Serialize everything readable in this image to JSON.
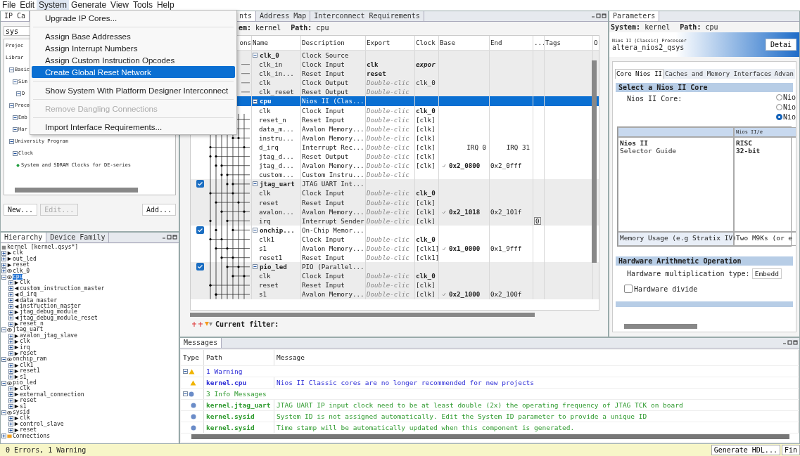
{
  "menubar": [
    {
      "label": "File",
      "open": false
    },
    {
      "label": "Edit",
      "open": false
    },
    {
      "label": "System",
      "open": true
    },
    {
      "label": "Generate",
      "open": false
    },
    {
      "label": "View",
      "open": false
    },
    {
      "label": "Tools",
      "open": false
    },
    {
      "label": "Help",
      "open": false
    }
  ],
  "system_menu": [
    {
      "kind": "item",
      "label": "Upgrade IP Cores...",
      "selected": false,
      "disabled": false
    },
    {
      "kind": "separator"
    },
    {
      "kind": "item",
      "label": "Assign Base Addresses",
      "selected": false,
      "disabled": false
    },
    {
      "kind": "item",
      "label": "Assign Interrupt Numbers",
      "selected": false,
      "disabled": false
    },
    {
      "kind": "item",
      "label": "Assign Custom Instruction Opcodes",
      "selected": false,
      "disabled": false
    },
    {
      "kind": "item",
      "label": "Create Global Reset Network",
      "selected": true,
      "disabled": false
    },
    {
      "kind": "separator"
    },
    {
      "kind": "item",
      "label": "Show System With Platform Designer Interconnect",
      "selected": false,
      "disabled": false
    },
    {
      "kind": "separator"
    },
    {
      "kind": "item",
      "label": "Remove Dangling Connections",
      "selected": false,
      "disabled": true
    },
    {
      "kind": "separator"
    },
    {
      "kind": "item",
      "label": "Import Interface Requirements...",
      "selected": false,
      "disabled": false
    }
  ],
  "ip_catalog": {
    "tab": "IP Ca",
    "search": "sys",
    "tree": [
      {
        "label": "Projec"
      },
      {
        "label": "Librar",
        "children": [
          {
            "label": "Basic",
            "expanded": true,
            "children": [
              {
                "label": "Sim",
                "expanded": true,
                "children": [
                  {
                    "label": "D",
                    "expanded": true
                  }
                ]
              }
            ]
          },
          {
            "label": "Proce",
            "expanded": true,
            "children": [
              {
                "label": "Emb",
                "expanded": true
              },
              {
                "label": "Har",
                "expanded": true
              }
            ]
          },
          {
            "label": "University Program",
            "expanded": true,
            "children": [
              {
                "label": "Clock",
                "expanded": true,
                "children": [
                  {
                    "label": "System and SDRAM Clocks for DE-series"
                  }
                ]
              }
            ]
          }
        ]
      }
    ],
    "buttons": [
      {
        "label": "New...",
        "disabled": false
      },
      {
        "label": "Edit...",
        "disabled": true
      },
      {
        "label": "Add...",
        "disabled": false
      }
    ]
  },
  "hierarchy": {
    "tabs": [
      {
        "label": "Hierarchy",
        "selected": true
      },
      {
        "label": "Device Family",
        "selected": false
      }
    ],
    "tree": {
      "label": "kernel [kernel.qsys*]",
      "kind": "system",
      "children": [
        {
          "label": "clk",
          "kind": "in",
          "expanded": false
        },
        {
          "label": "out_led",
          "kind": "in",
          "expanded": false
        },
        {
          "label": "reset",
          "kind": "in",
          "expanded": false
        },
        {
          "label": "clk_0",
          "kind": "module",
          "expanded": false
        },
        {
          "label": "cpu",
          "kind": "module",
          "expanded": true,
          "selected": true,
          "children": [
            {
              "label": "clk",
              "kind": "in",
              "expanded": false
            },
            {
              "label": "custom_instruction_master",
              "kind": "out",
              "expanded": false
            },
            {
              "label": "d_irq",
              "kind": "out",
              "expanded": false
            },
            {
              "label": "data_master",
              "kind": "out",
              "expanded": false
            },
            {
              "label": "instruction_master",
              "kind": "out",
              "expanded": false
            },
            {
              "label": "jtag_debug_module",
              "kind": "in",
              "expanded": false
            },
            {
              "label": "jtag_debug_module_reset",
              "kind": "out",
              "expanded": false
            },
            {
              "label": "reset_n",
              "kind": "in",
              "expanded": false
            }
          ]
        },
        {
          "label": "jtag_uart",
          "kind": "module",
          "expanded": true,
          "children": [
            {
              "label": "avalon_jtag_slave",
              "kind": "in",
              "expanded": false
            },
            {
              "label": "clk",
              "kind": "in",
              "expanded": false
            },
            {
              "label": "irq",
              "kind": "in",
              "expanded": false
            },
            {
              "label": "reset",
              "kind": "in",
              "expanded": false
            }
          ]
        },
        {
          "label": "onchip_ram",
          "kind": "module",
          "expanded": true,
          "children": [
            {
              "label": "clk1",
              "kind": "in",
              "expanded": false
            },
            {
              "label": "reset1",
              "kind": "in",
              "expanded": false
            },
            {
              "label": "s1",
              "kind": "in",
              "expanded": false
            }
          ]
        },
        {
          "label": "pio_led",
          "kind": "module",
          "expanded": true,
          "children": [
            {
              "label": "clk",
              "kind": "in",
              "expanded": false
            },
            {
              "label": "external_connection",
              "kind": "in",
              "expanded": false
            },
            {
              "label": "reset",
              "kind": "in",
              "expanded": false
            },
            {
              "label": "s1",
              "kind": "in",
              "expanded": false
            }
          ]
        },
        {
          "label": "sysid",
          "kind": "module",
          "expanded": true,
          "children": [
            {
              "label": "clk",
              "kind": "in",
              "expanded": false
            },
            {
              "label": "control_slave",
              "kind": "in",
              "expanded": false
            },
            {
              "label": "reset",
              "kind": "in",
              "expanded": false
            }
          ]
        },
        {
          "label": "Connections",
          "kind": "folder",
          "expanded": false
        }
      ]
    }
  },
  "system_contents": {
    "tabs": [
      {
        "label": "nts",
        "selected": true
      },
      {
        "label": "Address Map",
        "selected": false
      },
      {
        "label": "Interconnect Requirements",
        "selected": false
      }
    ],
    "system_label": "em:",
    "system": "kernel",
    "path_label": "Path:",
    "path": "cpu",
    "columns": [
      "ons",
      "Name",
      "Description",
      "Export",
      "Clock",
      "Base",
      "End",
      "...",
      "Tags",
      "O"
    ],
    "modules": [
      {
        "name": "clk_0",
        "description": "Clock Source",
        "selected": false,
        "expanded": true,
        "ports": [
          {
            "name": "clk_in",
            "description": "Clock Input",
            "export": {
              "text": "clk",
              "kind": "name"
            },
            "clock": {
              "text": "expor",
              "kind": "italic"
            }
          },
          {
            "name": "clk_in...",
            "description": "Reset Input",
            "export": {
              "text": "reset",
              "kind": "name"
            }
          },
          {
            "name": "clk",
            "description": "Clock Output",
            "export": {
              "text": "Double-clic",
              "kind": "hint"
            },
            "clock": {
              "text": "clk_0",
              "kind": "plain"
            }
          },
          {
            "name": "clk_reset",
            "description": "Reset Output",
            "export": {
              "text": "Double-clic",
              "kind": "hint"
            }
          }
        ]
      },
      {
        "name": "cpu",
        "description": "Nios II (Clas...",
        "selected": true,
        "expanded": true,
        "ports": [
          {
            "name": "clk",
            "description": "Clock Input",
            "export": {
              "text": "Double-clic",
              "kind": "hint"
            },
            "clock": {
              "text": "clk_0",
              "kind": "bold"
            }
          },
          {
            "name": "reset_n",
            "description": "Reset Input",
            "export": {
              "text": "Double-clic",
              "kind": "hint"
            },
            "clock": {
              "text": "[clk]",
              "kind": "plain"
            }
          },
          {
            "name": "data_m...",
            "description": "Avalon Memory...",
            "export": {
              "text": "Double-clic",
              "kind": "hint"
            },
            "clock": {
              "text": "[clk]",
              "kind": "plain"
            }
          },
          {
            "name": "instru...",
            "description": "Avalon Memory...",
            "export": {
              "text": "Double-clic",
              "kind": "hint"
            },
            "clock": {
              "text": "[clk]",
              "kind": "plain"
            }
          },
          {
            "name": "d_irq",
            "description": "Interrupt Rec...",
            "export": {
              "text": "Double-clic",
              "kind": "hint"
            },
            "clock": {
              "text": "[clk]",
              "kind": "plain"
            },
            "base": {
              "text": "IRQ 0",
              "kind": "irq"
            },
            "end": "IRQ 31"
          },
          {
            "name": "jtag_d...",
            "description": "Reset Output",
            "export": {
              "text": "Double-clic",
              "kind": "hint"
            },
            "clock": {
              "text": "[clk]",
              "kind": "plain"
            }
          },
          {
            "name": "jtag_d...",
            "description": "Avalon Memory...",
            "export": {
              "text": "Double-clic",
              "kind": "hint"
            },
            "clock": {
              "text": "[clk]",
              "kind": "plain"
            },
            "base": {
              "text": "0x2_0800",
              "kind": "address"
            },
            "end": "0x2_0fff"
          },
          {
            "name": "custom...",
            "description": "Custom Instru...",
            "export": {
              "text": "Double-clic",
              "kind": "hint"
            }
          }
        ]
      },
      {
        "name": "jtag_uart",
        "description": "JTAG UART Int...",
        "checked": true,
        "selected": false,
        "expanded": true,
        "ports": [
          {
            "name": "clk",
            "description": "Clock Input",
            "export": {
              "text": "Double-clic",
              "kind": "hint"
            },
            "clock": {
              "text": "clk_0",
              "kind": "bold"
            }
          },
          {
            "name": "reset",
            "description": "Reset Input",
            "export": {
              "text": "Double-clic",
              "kind": "hint"
            },
            "clock": {
              "text": "[clk]",
              "kind": "plain"
            }
          },
          {
            "name": "avalon...",
            "description": "Avalon Memory...",
            "export": {
              "text": "Double-clic",
              "kind": "hint"
            },
            "clock": {
              "text": "[clk]",
              "kind": "plain"
            },
            "base": {
              "text": "0x2_1018",
              "kind": "address"
            },
            "end": "0x2_101f"
          },
          {
            "name": "irq",
            "description": "Interrupt Sender",
            "export": {
              "text": "Double-clic",
              "kind": "hint"
            },
            "clock": {
              "text": "[clk]",
              "kind": "plain"
            },
            "irq": "0"
          }
        ]
      },
      {
        "name": "onchip...",
        "description": "On-Chip Memor...",
        "checked": true,
        "selected": false,
        "expanded": true,
        "ports": [
          {
            "name": "clk1",
            "description": "Clock Input",
            "export": {
              "text": "Double-clic",
              "kind": "hint"
            },
            "clock": {
              "text": "clk_0",
              "kind": "bold"
            }
          },
          {
            "name": "s1",
            "description": "Avalon Memory...",
            "export": {
              "text": "Double-clic",
              "kind": "hint"
            },
            "clock": {
              "text": "[clk1]",
              "kind": "plain"
            },
            "base": {
              "text": "0x1_0000",
              "kind": "address"
            },
            "end": "0x1_9fff"
          },
          {
            "name": "reset1",
            "description": "Reset Input",
            "export": {
              "text": "Double-clic",
              "kind": "hint"
            },
            "clock": {
              "text": "[clk1]",
              "kind": "plain"
            }
          }
        ]
      },
      {
        "name": "pio_led",
        "description": "PIO (Parallel...",
        "checked": true,
        "selected": false,
        "expanded": true,
        "ports": [
          {
            "name": "clk",
            "description": "Clock Input",
            "export": {
              "text": "Double-clic",
              "kind": "hint"
            },
            "clock": {
              "text": "clk_0",
              "kind": "bold"
            }
          },
          {
            "name": "reset",
            "description": "Reset Input",
            "export": {
              "text": "Double-clic",
              "kind": "hint"
            },
            "clock": {
              "text": "[clk]",
              "kind": "plain"
            }
          },
          {
            "name": "s1",
            "description": "Avalon Memory...",
            "export": {
              "text": "Double-clic",
              "kind": "hint"
            },
            "clock": {
              "text": "[clk]",
              "kind": "plain"
            },
            "base": {
              "text": "0x2_1000",
              "kind": "address"
            },
            "end": "0x2_100f"
          }
        ]
      }
    ],
    "filter_label": "Current filter:"
  },
  "parameters": {
    "tab": "Parameters",
    "system_label": "System:",
    "system": "kernel",
    "path_label": "Path:",
    "path": "cpu",
    "component_type": "Nios II (Classic) Processor",
    "component_name": "altera_nios2_qsys",
    "details_button": "Detai",
    "tabs": [
      {
        "label": "Core Nios II",
        "selected": true
      },
      {
        "label": "Caches and Memory Interfaces",
        "selected": false
      },
      {
        "label": "Advan",
        "selected": false
      }
    ],
    "core_section": "Select a Nios II Core",
    "core_label": "Nios II Core:",
    "core_options": [
      {
        "label": "Nio",
        "selected": false
      },
      {
        "label": "Nio",
        "selected": false
      },
      {
        "label": "Nio",
        "selected": true
      }
    ],
    "selector": {
      "header": "Nios II/e",
      "title": "Nios II",
      "subtitle": "Selector Guide",
      "col_lines": [
        "RISC",
        "32-bit"
      ],
      "footer_label": "Memory Usage (e.g Stratix IV)",
      "footer_value": "Two M9Ks (or e"
    },
    "arith_section": "Hardware Arithmetic Operation",
    "mult_label": "Hardware multiplication type:",
    "mult_value": "Embedd",
    "divide": {
      "label": "Hardware divide",
      "checked": false
    }
  },
  "messages": {
    "tab": "Messages",
    "columns": [
      "Type",
      "Path",
      "Message"
    ],
    "groups": [
      {
        "kind": "warning",
        "title": "1 Warning",
        "expanded": true,
        "items": [
          {
            "path": "kernel.cpu",
            "message": "Nios II Classic cores are no longer recommended for new projects"
          }
        ]
      },
      {
        "kind": "info",
        "title": "3 Info Messages",
        "expanded": true,
        "items": [
          {
            "path": "kernel.jtag_uart",
            "message": "JTAG UART IP input clock need to be at least double (2x) the operating frequency of JTAG TCK on board"
          },
          {
            "path": "kernel.sysid",
            "message": "System ID is not assigned automatically. Edit the System ID parameter to provide a unique ID"
          },
          {
            "path": "kernel.sysid",
            "message": "Time stamp will be automatically updated when this component is generated."
          }
        ]
      }
    ]
  },
  "status_bar": {
    "text": "0 Errors, 1 Warning",
    "buttons": [
      "Generate HDL...",
      "Fin"
    ]
  }
}
